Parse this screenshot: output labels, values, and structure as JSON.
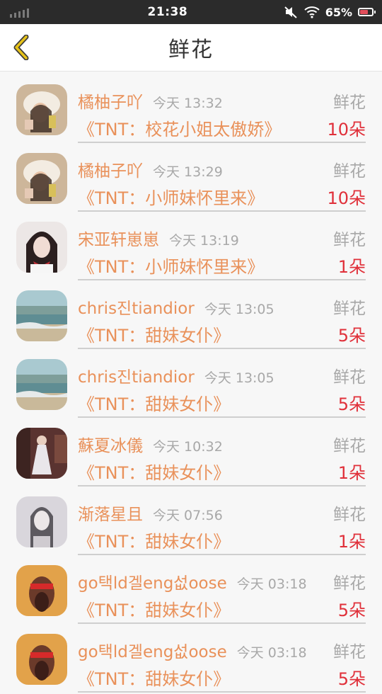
{
  "status": {
    "time": "21:38",
    "battery": "65%"
  },
  "header": {
    "title": "鲜花"
  },
  "items": [
    {
      "user": "橘柚子吖",
      "time": "今天 13:32",
      "type": "鲜花",
      "song": "《TNT：校花小姐太傲娇》",
      "count": "10朵",
      "avatar": "girl-hat-photo"
    },
    {
      "user": "橘柚子吖",
      "time": "今天 13:29",
      "type": "鲜花",
      "song": "《TNT：小师妹怀里来》",
      "count": "10朵",
      "avatar": "girl-hat-photo"
    },
    {
      "user": "宋亚轩崽崽",
      "time": "今天 13:19",
      "type": "鲜花",
      "song": "《TNT：小师妹怀里来》",
      "count": "1朵",
      "avatar": "girl-bow-photo"
    },
    {
      "user": "chris진tiandior",
      "time": "今天 13:05",
      "type": "鲜花",
      "song": "《TNT：甜妹女仆》",
      "count": "5朵",
      "avatar": "beach-photo"
    },
    {
      "user": "chris진tiandior",
      "time": "今天 13:05",
      "type": "鲜花",
      "song": "《TNT：甜妹女仆》",
      "count": "5朵",
      "avatar": "beach-photo"
    },
    {
      "user": "蘇夏冰儀",
      "time": "今天 10:32",
      "type": "鲜花",
      "song": "《TNT：甜妹女仆》",
      "count": "1朵",
      "avatar": "girl-dress-photo"
    },
    {
      "user": "渐落星且",
      "time": "今天 07:56",
      "type": "鲜花",
      "song": "《TNT：甜妹女仆》",
      "count": "1朵",
      "avatar": "girl-pale-photo"
    },
    {
      "user": "go택ld겔eng섮oose",
      "time": "今天 03:18",
      "type": "鲜花",
      "song": "《TNT：甜妹女仆》",
      "count": "5朵",
      "avatar": "red-face-photo"
    },
    {
      "user": "go택ld겔eng섮oose",
      "time": "今天 03:18",
      "type": "鲜花",
      "song": "《TNT：甜妹女仆》",
      "count": "5朵",
      "avatar": "red-face-photo"
    }
  ],
  "colors": {
    "name": "#e9915a",
    "count": "#e0303a",
    "muted": "#a8a8a8",
    "back_arrow": "#e6c21a"
  }
}
